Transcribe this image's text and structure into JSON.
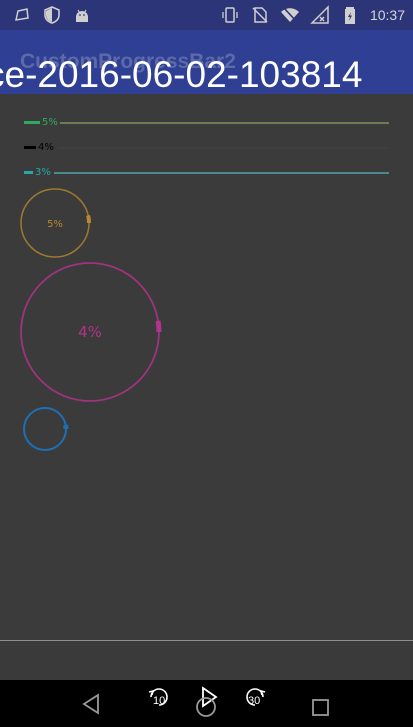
{
  "statusbar": {
    "time": "10:37",
    "left_icons": [
      "notification-icon",
      "shield-icon",
      "android-icon"
    ],
    "right_icons": [
      "vibrate-icon",
      "no-sim-icon",
      "wifi-icon",
      "signal-icon",
      "battery-icon"
    ]
  },
  "appbar": {
    "title": "CustomProgressBar2",
    "overlay_filename": "ce-2016-06-02-103814",
    "background": "#2f3f93"
  },
  "progress_bars": [
    {
      "label": "5%",
      "progress": 5,
      "color": "#2eaa5e",
      "track_color": "#6f7a56"
    },
    {
      "label": "4%",
      "progress": 4,
      "color": "#000000",
      "track_color": "#3f3f3f"
    },
    {
      "label": "3%",
      "progress": 3,
      "color": "#27a8a8",
      "track_color": "#4a8a8e"
    }
  ],
  "rings": [
    {
      "label": "5%",
      "progress": 5,
      "color": "#b88a2c",
      "label_color": "#b88a2c"
    },
    {
      "label": "4%",
      "progress": 4,
      "color": "#b0338c",
      "label_color": "#b0338c"
    },
    {
      "label": "",
      "progress": 3,
      "color": "#1f6fb4",
      "label_color": "#1f6fb4"
    }
  ],
  "media_controls": {
    "rewind_seconds": "10",
    "forward_seconds": "30"
  },
  "navbar": {
    "buttons": [
      "back-icon",
      "home-icon",
      "recents-icon"
    ]
  }
}
